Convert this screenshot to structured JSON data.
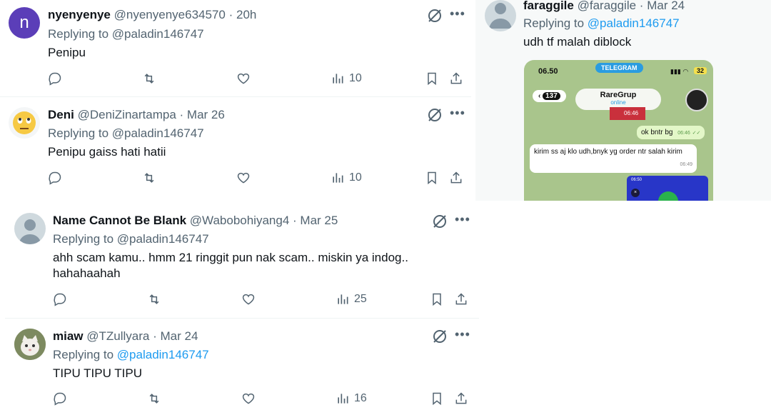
{
  "tweets": [
    {
      "name": "nyenyenye",
      "handle": "@nyenyenye634570",
      "sep": "·",
      "date": "20h",
      "reply_prefix": "Replying to",
      "reply_handle": "@paladin146747",
      "text": "Penipu",
      "views": "10",
      "avatar_letter": "n"
    },
    {
      "name": "Deni",
      "handle": "@DeniZinartampa",
      "sep": "·",
      "date": "Mar 26",
      "reply_prefix": "Replying to",
      "reply_handle": "@paladin146747",
      "text": "Penipu gaiss hati hatii",
      "views": "10"
    },
    {
      "name": "Name Cannot Be Blank",
      "handle": "@Wabobohiyang4",
      "sep": "·",
      "date": "Mar 25",
      "reply_prefix": "Replying to",
      "reply_handle": "@paladin146747",
      "text_line1": "ahh scam kamu.. hmm 21 ringgit pun nak scam.. miskin ya indog..",
      "text_line2": "hahahaahah",
      "views": "25"
    },
    {
      "name": "miaw",
      "handle": "@TZullyara",
      "sep": "·",
      "date": "Mar 24",
      "reply_prefix": "Replying to",
      "reply_handle": "@paladin146747",
      "text": "TIPU TIPU TIPU",
      "views": "16"
    }
  ],
  "right_tweet": {
    "name": "faraggile",
    "handle": "@faraggile",
    "sep": "·",
    "date": "Mar 24",
    "reply_prefix": "Replying to",
    "reply_handle": "@paladin146747",
    "text": "udh tf malah diblock",
    "screenshot": {
      "time": "06.50",
      "app_badge": "TELEGRAM",
      "back_count": "137",
      "chat_name": "RareGrup",
      "chat_status": "online",
      "battery": "32",
      "msg_out": "ok bntr bg",
      "msg_out_time": "06:46",
      "msg_in": "kirim ss aj klo udh,bnyk yg order ntr salah kirim",
      "msg_in_time": "06:49",
      "mini_time": "06:50",
      "top_time": "06:46"
    }
  },
  "colors": {
    "accent": "#1d9bf0",
    "text": "#0f1419",
    "muted": "#536471",
    "avatar_n": "#5b3eb8",
    "telegram_bg": "#a9c58c"
  }
}
